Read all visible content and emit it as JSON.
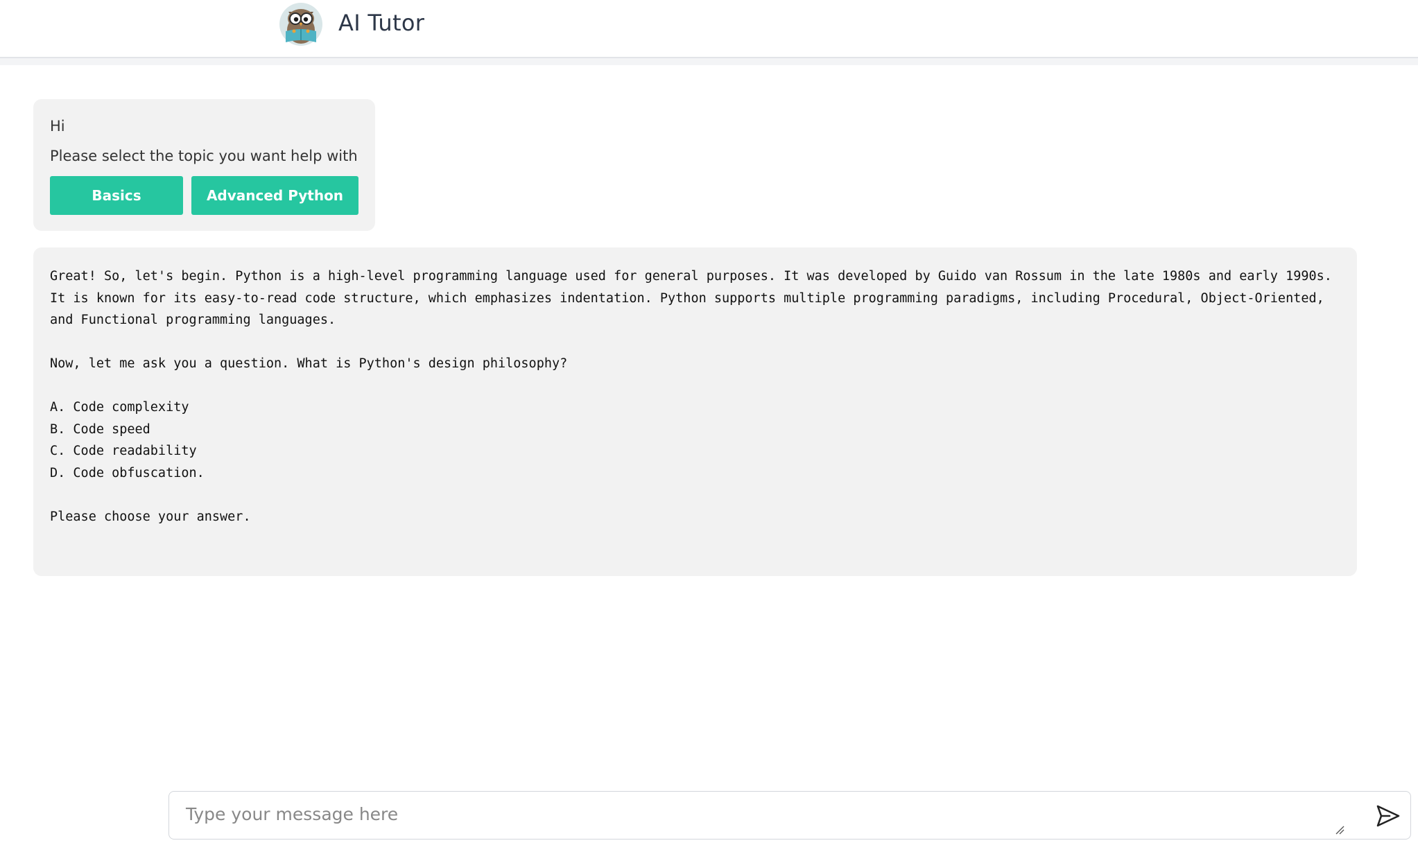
{
  "header": {
    "logo_icon": "owl-reading-book-icon",
    "title": "AI Tutor"
  },
  "greeting": {
    "hi": "Hi",
    "prompt": "Please select the topic you want help with",
    "buttons": {
      "basics": "Basics",
      "advanced": "Advanced Python"
    }
  },
  "answer": {
    "text": "Great! So, let's begin. Python is a high-level programming language used for general purposes. It was developed by Guido van Rossum in the late 1980s and early 1990s. It is known for its easy-to-read code structure, which emphasizes indentation. Python supports multiple programming paradigms, including Procedural, Object-Oriented, and Functional programming languages.\n\nNow, let me ask you a question. What is Python's design philosophy?\n\nA. Code complexity\nB. Code speed\nC. Code readability\nD. Code obfuscation.\n\nPlease choose your answer."
  },
  "composer": {
    "placeholder": "Type your message here",
    "value": "",
    "send_icon": "send-icon"
  },
  "colors": {
    "accent": "#26c6a0",
    "bubble_bg": "#f2f2f2",
    "title": "#2d3748"
  }
}
